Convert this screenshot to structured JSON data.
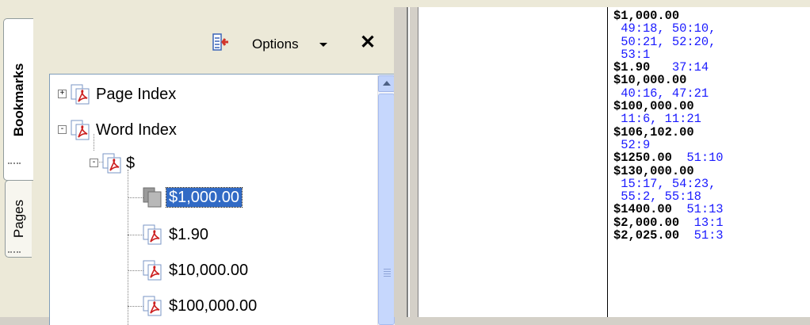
{
  "side_tabs": [
    {
      "label": "Bookmarks",
      "active": true
    },
    {
      "label": "Pages",
      "active": false
    }
  ],
  "toolbar": {
    "options_label": "Options",
    "options_icon": "options-menu-icon",
    "close_glyph": "✕"
  },
  "bookmarks": [
    {
      "label": "Page Index",
      "level": 0,
      "expander": "+",
      "icon": "pdf-bookmark-icon"
    },
    {
      "label": "Word Index",
      "level": 0,
      "expander": "-",
      "icon": "pdf-bookmark-icon"
    },
    {
      "label": "$",
      "level": 1,
      "expander": "-",
      "icon": "pdf-bookmark-icon"
    },
    {
      "label": "$1,000.00",
      "level": 2,
      "expander": "",
      "icon": "blank-bookmark-icon",
      "selected": true
    },
    {
      "label": "$1.90",
      "level": 2,
      "expander": "",
      "icon": "pdf-bookmark-icon"
    },
    {
      "label": "$10,000.00",
      "level": 2,
      "expander": "",
      "icon": "pdf-bookmark-icon"
    },
    {
      "label": "$100,000.00",
      "level": 2,
      "expander": "",
      "icon": "pdf-bookmark-icon"
    }
  ],
  "word_index_lines": [
    [
      {
        "text": "$1,000.00",
        "kind": "term"
      }
    ],
    [
      {
        "text": " 49:18, 50:10,",
        "kind": "ref"
      }
    ],
    [
      {
        "text": " 50:21, 52:20,",
        "kind": "ref"
      }
    ],
    [
      {
        "text": " 53:1",
        "kind": "ref"
      }
    ],
    [
      {
        "text": "$1.90",
        "kind": "term"
      },
      {
        "text": "   37:14",
        "kind": "ref"
      }
    ],
    [
      {
        "text": "$10,000.00",
        "kind": "term"
      }
    ],
    [
      {
        "text": " 40:16, 47:21",
        "kind": "ref"
      }
    ],
    [
      {
        "text": "$100,000.00",
        "kind": "term"
      }
    ],
    [
      {
        "text": " 11:6, 11:21",
        "kind": "ref"
      }
    ],
    [
      {
        "text": "$106,102.00",
        "kind": "term"
      }
    ],
    [
      {
        "text": " 52:9",
        "kind": "ref"
      }
    ],
    [
      {
        "text": "$1250.00",
        "kind": "term"
      },
      {
        "text": "  51:10",
        "kind": "ref"
      }
    ],
    [
      {
        "text": "$130,000.00",
        "kind": "term"
      }
    ],
    [
      {
        "text": " 15:17, 54:23,",
        "kind": "ref"
      }
    ],
    [
      {
        "text": " 55:2, 55:18",
        "kind": "ref"
      }
    ],
    [
      {
        "text": "$1400.00",
        "kind": "term"
      },
      {
        "text": "  51:13",
        "kind": "ref"
      }
    ],
    [
      {
        "text": "$2,000.00",
        "kind": "term"
      },
      {
        "text": "  13:1",
        "kind": "ref"
      }
    ],
    [
      {
        "text": "$2,025.00",
        "kind": "term"
      },
      {
        "text": "  51:3",
        "kind": "ref"
      }
    ]
  ],
  "colors": {
    "selection": "#316ac5",
    "page_ref_blue": "#1a1aff",
    "pdf_red": "#cc1f1f"
  }
}
